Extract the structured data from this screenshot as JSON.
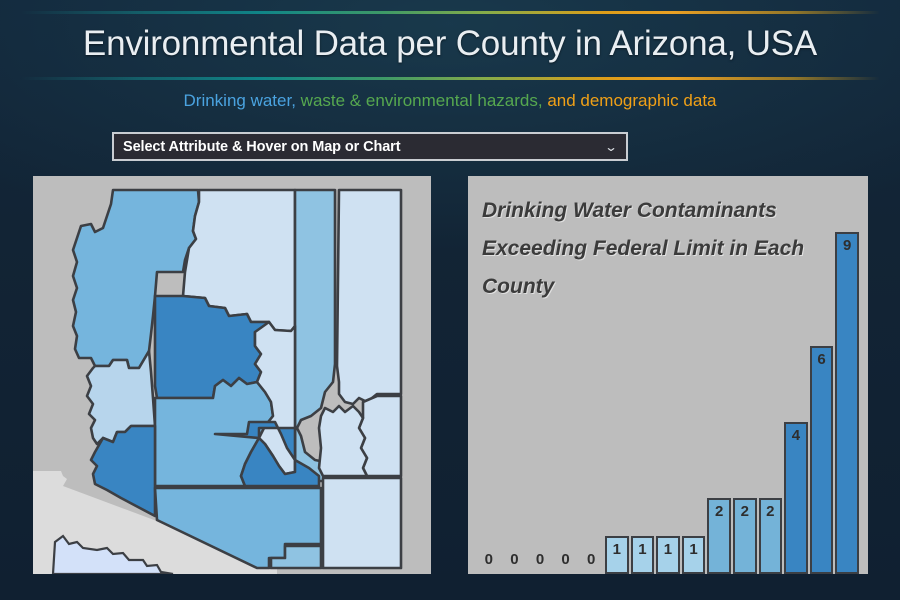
{
  "header": {
    "title": "Environmental Data per County in Arizona, USA",
    "subtitle_parts": [
      {
        "text": "Drinking water,",
        "color": "#4aa3e0"
      },
      {
        "text": "waste & environmental hazards,",
        "color": "#56a84f"
      },
      {
        "text": "and demographic data",
        "color": "#f0a017"
      }
    ]
  },
  "controls": {
    "attribute_select": {
      "selected": "Select Attribute & Hover on Map or Chart",
      "arrow_icon": "chevron-down-icon"
    }
  },
  "map": {
    "panel_background": "#bdbdbd",
    "outside_fill": "#bdbdbd",
    "mexico_fill": "#dcdcdc",
    "stroke": "#3c3f44",
    "legend_colors": [
      "#cfe1f2",
      "#b7d5ec",
      "#8fc3e2",
      "#75b5dd",
      "#3985c2"
    ]
  },
  "chart_data": {
    "type": "bar",
    "title": "Drinking Water Contaminants Exceeding Federal Limit in Each County",
    "xlabel": "",
    "ylabel": "",
    "ylim": [
      0,
      9
    ],
    "grid": false,
    "legend": "none",
    "categories": [
      "",
      "",
      "",
      "",
      "",
      "",
      "",
      "",
      "",
      "",
      "",
      "",
      "",
      "",
      ""
    ],
    "values": [
      0,
      0,
      0,
      0,
      0,
      1,
      1,
      1,
      1,
      2,
      2,
      2,
      4,
      6,
      9
    ],
    "bar_colors": [
      "#bdbdbd",
      "#bdbdbd",
      "#bdbdbd",
      "#bdbdbd",
      "#bdbdbd",
      "#a6d2ea",
      "#a6d2ea",
      "#a6d2ea",
      "#a6d2ea",
      "#74b3d8",
      "#74b3d8",
      "#74b3d8",
      "#3985c2",
      "#3985c2",
      "#3985c2"
    ],
    "data_labels": [
      "0",
      "0",
      "0",
      "0",
      "0",
      "1",
      "1",
      "1",
      "1",
      "2",
      "2",
      "2",
      "4",
      "6",
      "9"
    ]
  }
}
